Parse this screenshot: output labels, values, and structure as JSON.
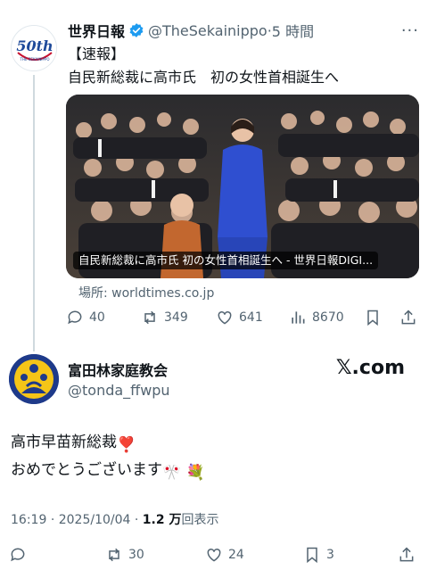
{
  "parent_tweet": {
    "name": "世界日報",
    "handle": "@TheSekainippo",
    "separator": "·",
    "time": "5 時間",
    "more": "···",
    "avatar_text": "50th",
    "avatar_subtext": "THE SEKAINIPPO",
    "line1": "【速報】",
    "line2": "自民新総裁に高市氏　初の女性首相誕生へ",
    "card_caption": "自民新総裁に高市氏 初の女性首相誕生へ - 世界日報DIGI...",
    "source": "場所: worldtimes.co.jp",
    "replies": "40",
    "retweets": "349",
    "likes": "641",
    "views": "8670"
  },
  "main_tweet": {
    "name": "富田林家庭教会",
    "handle": "@tonda_ffwpu",
    "brand": "𝕏.com",
    "text1": "高市早苗新総裁",
    "text1_emoji": "❣️",
    "text2": "おめでとうございます",
    "text2_emoji": "🎌 💐",
    "time": "16:19",
    "sep": "·",
    "date": "2025/10/04",
    "views_count": "1.2 万",
    "views_label": "回表示",
    "retweets": "30",
    "likes": "24",
    "bookmarks": "3"
  },
  "colors": {
    "secondary_text": "#536471",
    "verified_blue": "#1d9bf0",
    "avatar2_bg": "#1e3a8a"
  }
}
